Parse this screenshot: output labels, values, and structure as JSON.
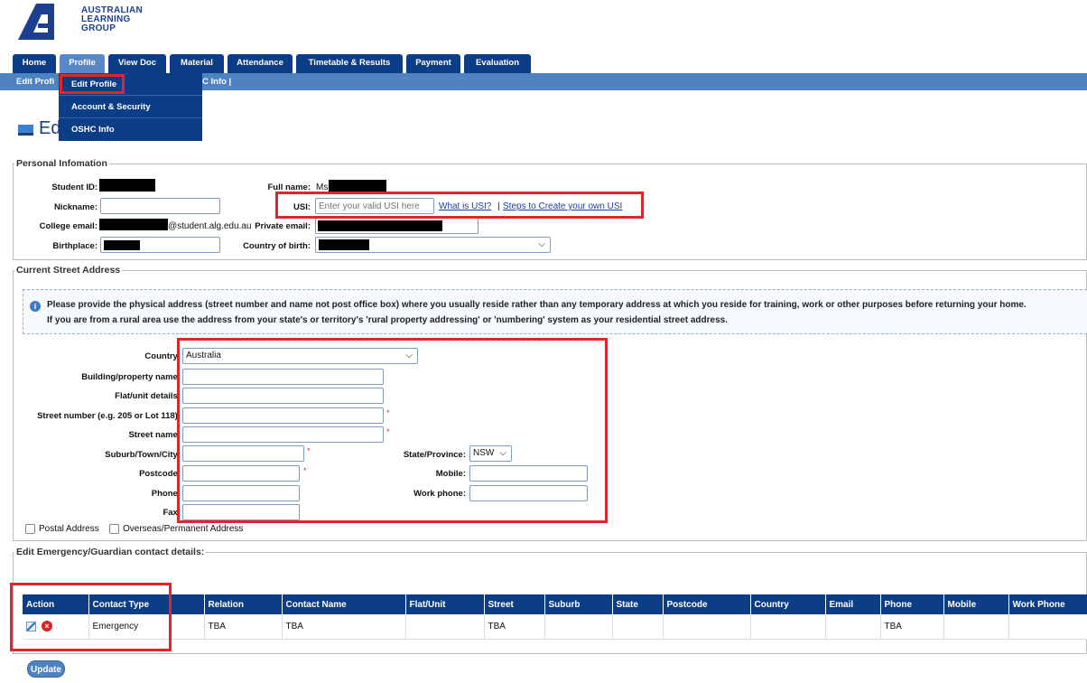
{
  "brand": {
    "line1": "AUSTRALIAN",
    "line2": "LEARNING",
    "line3": "GROUP",
    "color": "#1d3f8f"
  },
  "tabs": [
    {
      "label": "Home"
    },
    {
      "label": "Profile"
    },
    {
      "label": "View Doc"
    },
    {
      "label": "Material"
    },
    {
      "label": "Attendance"
    },
    {
      "label": "Timetable & Results"
    },
    {
      "label": "Payment"
    },
    {
      "label": "Evaluation"
    }
  ],
  "subnav": {
    "left": "Edit Profi",
    "right": "C Info |"
  },
  "profile_menu": [
    "Edit Profile",
    "Account & Security",
    "OSHC Info"
  ],
  "page_title": "Ed",
  "personal": {
    "legend": "Personal Infomation",
    "student_id_label": "Student ID:",
    "full_name_label": "Full name:",
    "full_name_prefix": "Ms",
    "nickname_label": "Nickname:",
    "usi_label": "USI:",
    "usi_placeholder": "Enter your valid USI here",
    "what_is_usi": "What is USI?",
    "separator": "|",
    "steps_link": "Steps to Create your own USI",
    "college_email_label": "College email:",
    "college_email_domain": "@student.alg.edu.au",
    "private_email_label": "Private email:",
    "birthplace_label": "Birthplace:",
    "country_of_birth_label": "Country of birth:"
  },
  "address": {
    "legend": "Current Street Address",
    "info_line1": "Please provide the physical address (street number and name not post office box) where you usually reside rather than any temporary address at which you reside for training, work or other purposes before returning your home.",
    "info_line2": "If you are from a rural area use the address from your state's or territory's 'rural property addressing' or 'numbering' system as your residential street address.",
    "country_label": "Country:",
    "country_value": "Australia",
    "building_label": "Building/property name:",
    "flat_label": "Flat/unit details:",
    "street_number_label": "Street number (e.g. 205 or Lot 118):",
    "street_name_label": "Street name:",
    "suburb_label": "Suburb/Town/City:",
    "postcode_label": "Postcode:",
    "phone_label": "Phone:",
    "fax_label": "Fax:",
    "state_label": "State/Province:",
    "state_value": "NSW",
    "mobile_label": "Mobile:",
    "work_phone_label": "Work phone:",
    "required_mark": "*",
    "postal_label": "Postal Address",
    "overseas_label": "Overseas/Permanent Address"
  },
  "emergency": {
    "legend": "Edit Emergency/Guardian contact details:",
    "columns": [
      "Action",
      "Contact Type",
      "Relation",
      "Contact Name",
      "Flat/Unit",
      "Street",
      "Suburb",
      "State",
      "Postcode",
      "Country",
      "Email",
      "Phone",
      "Mobile",
      "Work Phone"
    ],
    "rows": [
      [
        "",
        "Emergency",
        "TBA",
        "TBA",
        "",
        "TBA",
        "",
        "",
        "",
        "",
        "",
        "TBA",
        "",
        ""
      ]
    ]
  },
  "update_label": "Update",
  "colors": {
    "nav": "#0c3d87",
    "subnav": "#4f83c0",
    "highlight": "#e0262a"
  },
  "icons": {
    "logo": "alg-logo-icon",
    "title": "monitor-icon",
    "info": "info-icon",
    "edit": "edit-icon",
    "delete": "delete-icon"
  }
}
